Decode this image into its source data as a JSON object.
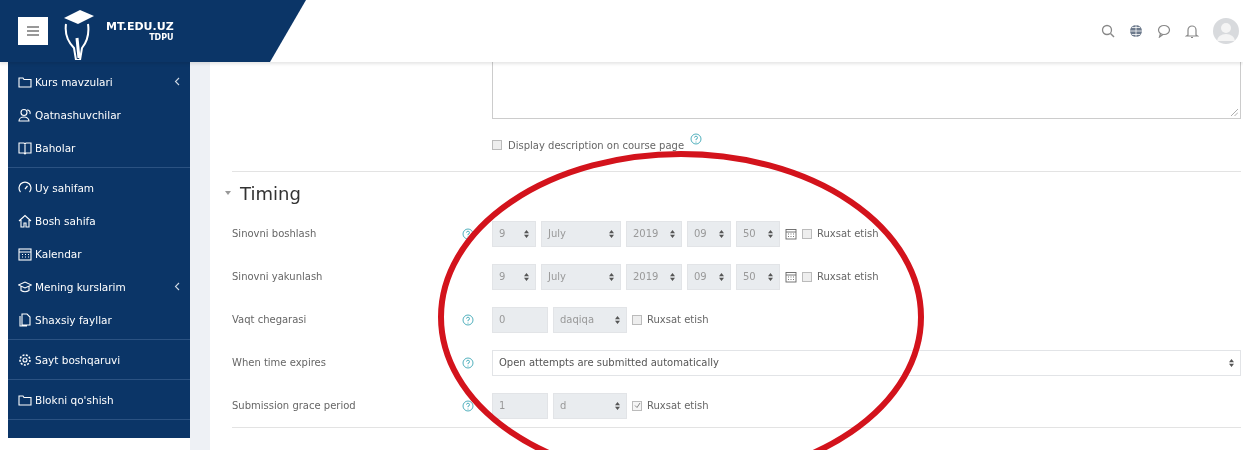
{
  "header": {
    "brand": "MT.EDU.UZ",
    "brand_sub": "TDPU"
  },
  "sidebar": {
    "groups": [
      {
        "items": [
          {
            "label": "Kurs mavzulari",
            "expandable": true
          },
          {
            "label": "Qatnashuvchilar",
            "expandable": false
          },
          {
            "label": "Baholar",
            "expandable": false
          }
        ]
      },
      {
        "items": [
          {
            "label": "Uy sahifam",
            "expandable": false
          },
          {
            "label": "Bosh sahifa",
            "expandable": false
          },
          {
            "label": "Kalendar",
            "expandable": false
          },
          {
            "label": "Mening kurslarim",
            "expandable": true
          },
          {
            "label": "Shaxsiy fayllar",
            "expandable": false
          }
        ]
      },
      {
        "items": [
          {
            "label": "Sayt boshqaruvi",
            "expandable": false
          }
        ]
      },
      {
        "items": [
          {
            "label": "Blokni qo'shish",
            "expandable": false
          }
        ]
      }
    ]
  },
  "description_option": {
    "label": "Display description on course page",
    "checked": false
  },
  "section": {
    "title": "Timing",
    "expanded": true,
    "rows": [
      {
        "kind": "datetime",
        "label": "Sinovni boshlash",
        "help": true,
        "values": [
          "9",
          "July",
          "2019",
          "09",
          "50"
        ],
        "enable": {
          "label": "Ruxsat etish",
          "checked": false
        }
      },
      {
        "kind": "datetime",
        "label": "Sinovni yakunlash",
        "help": false,
        "values": [
          "9",
          "July",
          "2019",
          "09",
          "50"
        ],
        "enable": {
          "label": "Ruxsat etish",
          "checked": false
        }
      },
      {
        "kind": "duration",
        "label": "Vaqt chegarasi",
        "help": true,
        "value": "0",
        "unit": "daqiqa",
        "enable": {
          "label": "Ruxsat etish",
          "checked": false
        }
      },
      {
        "kind": "select",
        "label": "When time expires",
        "help": true,
        "value": "Open attempts are submitted automatically"
      },
      {
        "kind": "duration",
        "label": "Submission grace period",
        "help": true,
        "value": "1",
        "unit": "d",
        "enable": {
          "label": "Ruxsat etish",
          "checked": true
        }
      }
    ]
  }
}
